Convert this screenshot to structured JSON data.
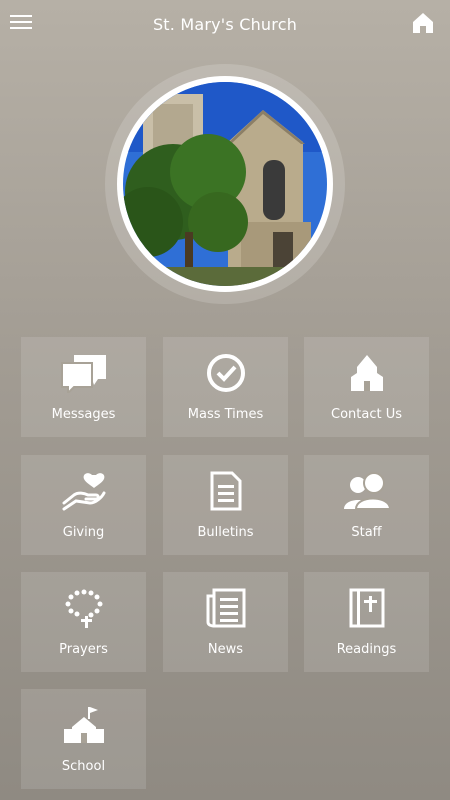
{
  "header": {
    "title": "St. Mary's Church",
    "menu_icon": "hamburger-menu-icon",
    "home_icon": "home-icon"
  },
  "hero": {
    "image": "church-photo"
  },
  "tiles": [
    {
      "label": "Messages",
      "icon": "chat-bubbles-icon"
    },
    {
      "label": "Mass Times",
      "icon": "clock-icon"
    },
    {
      "label": "Contact Us",
      "icon": "church-building-icon"
    },
    {
      "label": "Giving",
      "icon": "hand-heart-icon"
    },
    {
      "label": "Bulletins",
      "icon": "document-icon"
    },
    {
      "label": "Staff",
      "icon": "people-icon"
    },
    {
      "label": "Prayers",
      "icon": "rosary-icon"
    },
    {
      "label": "News",
      "icon": "newspaper-icon"
    },
    {
      "label": "Readings",
      "icon": "bible-icon"
    },
    {
      "label": "School",
      "icon": "school-building-icon"
    }
  ],
  "colors": {
    "background_top": "#b6b0a6",
    "background_bottom": "#8f8a82",
    "tile": "rgba(255,255,255,0.12)",
    "text": "#ffffff"
  }
}
